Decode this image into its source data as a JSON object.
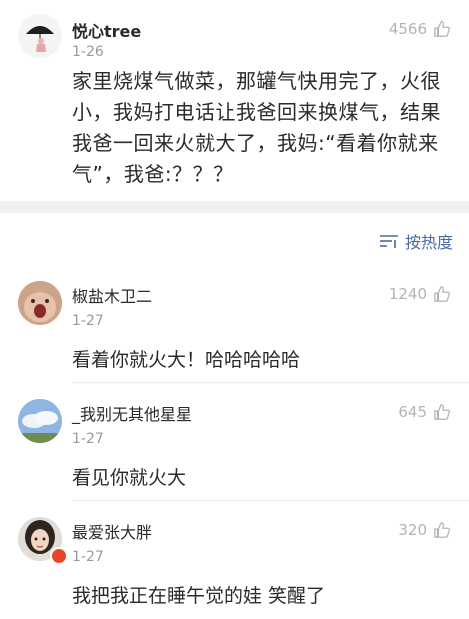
{
  "post": {
    "username": "悦心tree",
    "date": "1-26",
    "likes": "4566",
    "text": "家里烧煤气做菜，那罐气快用完了，火很小，我妈打电话让我爸回来换煤气，结果我爸一回来火就大了，我妈:“看着你就来气”，我爸:？？？"
  },
  "sort": {
    "label": "按热度"
  },
  "comments": [
    {
      "username": "椒盐木卫二",
      "date": "1-27",
      "likes": "1240",
      "text": "看着你就火大！哈哈哈哈哈"
    },
    {
      "username": "_我别无其他星星",
      "date": "1-27",
      "likes": "645",
      "text": "看见你就火大"
    },
    {
      "username": "最爱张大胖",
      "date": "1-27",
      "likes": "320",
      "text": "我把我正在睡午觉的娃 笑醒了"
    }
  ],
  "colors": {
    "link": "#4a6aa0",
    "muted": "#9a9a9a",
    "badge": "#e8452c"
  },
  "icons": {
    "like": "thumb-up-icon",
    "sort": "sort-lines-icon"
  }
}
